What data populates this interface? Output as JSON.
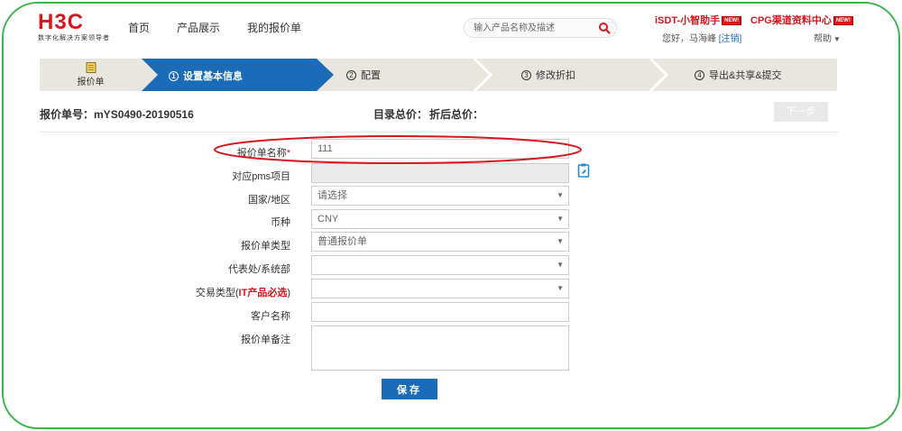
{
  "header": {
    "logo_text": "H3C",
    "logo_subtitle": "数字化解决方案领导者",
    "nav": [
      "首页",
      "产品展示",
      "我的报价单"
    ],
    "search_placeholder": "输入产品名称及描述",
    "promo1": "iSDT-小智助手",
    "promo2": "CPG渠道资料中心",
    "new_badge": "NEW!",
    "greeting": "您好，马海峰",
    "logout": "[注销]",
    "help": "帮助"
  },
  "wizard": {
    "home_label": "报价单",
    "steps": [
      {
        "num": "1",
        "label": "设置基本信息"
      },
      {
        "num": "2",
        "label": "配置"
      },
      {
        "num": "3",
        "label": "修改折扣"
      },
      {
        "num": "4",
        "label": "导出&共享&提交"
      }
    ]
  },
  "summary": {
    "quote_no_label": "报价单号：",
    "quote_no": "mYS0490-20190516",
    "catalog_total_label": "目录总价：",
    "discount_total_label": "折后总价：",
    "next_label": "下一步"
  },
  "form": {
    "name_label": "报价单名称",
    "name_required": "*",
    "name_value": "111",
    "pms_label": "对应pms项目",
    "country_label": "国家/地区",
    "country_value": "请选择",
    "currency_label": "币种",
    "currency_value": "CNY",
    "type_label": "报价单类型",
    "type_value": "普通报价单",
    "office_label": "代表处/系统部",
    "deal_label_prefix": "交易类型(",
    "deal_label_red": "IT产品必选",
    "deal_label_suffix": ")",
    "customer_label": "客户名称",
    "remark_label": "报价单备注",
    "save_label": "保存"
  },
  "colors": {
    "brand_red": "#d7161e",
    "active_step": "#1a6bb8",
    "frame_green": "#39b54a"
  }
}
